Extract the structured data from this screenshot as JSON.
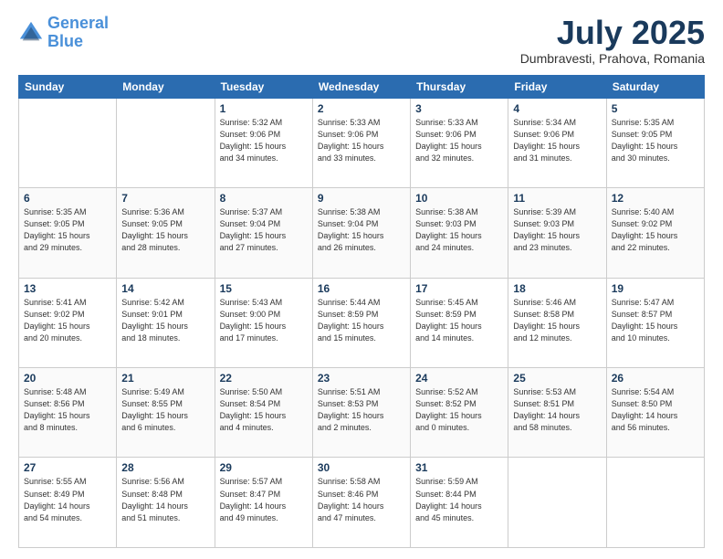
{
  "header": {
    "logo_line1": "General",
    "logo_line2": "Blue",
    "month": "July 2025",
    "location": "Dumbravesti, Prahova, Romania"
  },
  "weekdays": [
    "Sunday",
    "Monday",
    "Tuesday",
    "Wednesday",
    "Thursday",
    "Friday",
    "Saturday"
  ],
  "weeks": [
    [
      {
        "day": "",
        "info": ""
      },
      {
        "day": "",
        "info": ""
      },
      {
        "day": "1",
        "info": "Sunrise: 5:32 AM\nSunset: 9:06 PM\nDaylight: 15 hours\nand 34 minutes."
      },
      {
        "day": "2",
        "info": "Sunrise: 5:33 AM\nSunset: 9:06 PM\nDaylight: 15 hours\nand 33 minutes."
      },
      {
        "day": "3",
        "info": "Sunrise: 5:33 AM\nSunset: 9:06 PM\nDaylight: 15 hours\nand 32 minutes."
      },
      {
        "day": "4",
        "info": "Sunrise: 5:34 AM\nSunset: 9:06 PM\nDaylight: 15 hours\nand 31 minutes."
      },
      {
        "day": "5",
        "info": "Sunrise: 5:35 AM\nSunset: 9:05 PM\nDaylight: 15 hours\nand 30 minutes."
      }
    ],
    [
      {
        "day": "6",
        "info": "Sunrise: 5:35 AM\nSunset: 9:05 PM\nDaylight: 15 hours\nand 29 minutes."
      },
      {
        "day": "7",
        "info": "Sunrise: 5:36 AM\nSunset: 9:05 PM\nDaylight: 15 hours\nand 28 minutes."
      },
      {
        "day": "8",
        "info": "Sunrise: 5:37 AM\nSunset: 9:04 PM\nDaylight: 15 hours\nand 27 minutes."
      },
      {
        "day": "9",
        "info": "Sunrise: 5:38 AM\nSunset: 9:04 PM\nDaylight: 15 hours\nand 26 minutes."
      },
      {
        "day": "10",
        "info": "Sunrise: 5:38 AM\nSunset: 9:03 PM\nDaylight: 15 hours\nand 24 minutes."
      },
      {
        "day": "11",
        "info": "Sunrise: 5:39 AM\nSunset: 9:03 PM\nDaylight: 15 hours\nand 23 minutes."
      },
      {
        "day": "12",
        "info": "Sunrise: 5:40 AM\nSunset: 9:02 PM\nDaylight: 15 hours\nand 22 minutes."
      }
    ],
    [
      {
        "day": "13",
        "info": "Sunrise: 5:41 AM\nSunset: 9:02 PM\nDaylight: 15 hours\nand 20 minutes."
      },
      {
        "day": "14",
        "info": "Sunrise: 5:42 AM\nSunset: 9:01 PM\nDaylight: 15 hours\nand 18 minutes."
      },
      {
        "day": "15",
        "info": "Sunrise: 5:43 AM\nSunset: 9:00 PM\nDaylight: 15 hours\nand 17 minutes."
      },
      {
        "day": "16",
        "info": "Sunrise: 5:44 AM\nSunset: 8:59 PM\nDaylight: 15 hours\nand 15 minutes."
      },
      {
        "day": "17",
        "info": "Sunrise: 5:45 AM\nSunset: 8:59 PM\nDaylight: 15 hours\nand 14 minutes."
      },
      {
        "day": "18",
        "info": "Sunrise: 5:46 AM\nSunset: 8:58 PM\nDaylight: 15 hours\nand 12 minutes."
      },
      {
        "day": "19",
        "info": "Sunrise: 5:47 AM\nSunset: 8:57 PM\nDaylight: 15 hours\nand 10 minutes."
      }
    ],
    [
      {
        "day": "20",
        "info": "Sunrise: 5:48 AM\nSunset: 8:56 PM\nDaylight: 15 hours\nand 8 minutes."
      },
      {
        "day": "21",
        "info": "Sunrise: 5:49 AM\nSunset: 8:55 PM\nDaylight: 15 hours\nand 6 minutes."
      },
      {
        "day": "22",
        "info": "Sunrise: 5:50 AM\nSunset: 8:54 PM\nDaylight: 15 hours\nand 4 minutes."
      },
      {
        "day": "23",
        "info": "Sunrise: 5:51 AM\nSunset: 8:53 PM\nDaylight: 15 hours\nand 2 minutes."
      },
      {
        "day": "24",
        "info": "Sunrise: 5:52 AM\nSunset: 8:52 PM\nDaylight: 15 hours\nand 0 minutes."
      },
      {
        "day": "25",
        "info": "Sunrise: 5:53 AM\nSunset: 8:51 PM\nDaylight: 14 hours\nand 58 minutes."
      },
      {
        "day": "26",
        "info": "Sunrise: 5:54 AM\nSunset: 8:50 PM\nDaylight: 14 hours\nand 56 minutes."
      }
    ],
    [
      {
        "day": "27",
        "info": "Sunrise: 5:55 AM\nSunset: 8:49 PM\nDaylight: 14 hours\nand 54 minutes."
      },
      {
        "day": "28",
        "info": "Sunrise: 5:56 AM\nSunset: 8:48 PM\nDaylight: 14 hours\nand 51 minutes."
      },
      {
        "day": "29",
        "info": "Sunrise: 5:57 AM\nSunset: 8:47 PM\nDaylight: 14 hours\nand 49 minutes."
      },
      {
        "day": "30",
        "info": "Sunrise: 5:58 AM\nSunset: 8:46 PM\nDaylight: 14 hours\nand 47 minutes."
      },
      {
        "day": "31",
        "info": "Sunrise: 5:59 AM\nSunset: 8:44 PM\nDaylight: 14 hours\nand 45 minutes."
      },
      {
        "day": "",
        "info": ""
      },
      {
        "day": "",
        "info": ""
      }
    ]
  ]
}
